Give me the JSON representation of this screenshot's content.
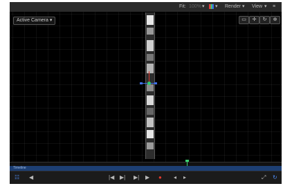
{
  "topbar": {
    "fit_label": "Fit:",
    "fit_value": "100%",
    "render_label": "Render",
    "view_label": "View",
    "layers_menu": "≡",
    "arrow": "▾"
  },
  "canvas": {
    "camera_dropdown": "Active Camera ▾",
    "cam_buttons": [
      "▭",
      "✢",
      "↻",
      "⊕"
    ]
  },
  "timeline": {
    "track_label": "Timeline"
  },
  "transport": {
    "buttons": {
      "layers": "☷",
      "back": "◀",
      "goto_start": "|◀",
      "step_back": "▶|",
      "play": "▶",
      "record": "●",
      "prev": "◂",
      "next": "▸",
      "expand": "⤢",
      "loop": "↻"
    }
  },
  "colors": {
    "record": "#e2392f",
    "accent_blue": "#3f6fe6",
    "playhead": "#3bd16f",
    "track": "#1d3f73"
  }
}
